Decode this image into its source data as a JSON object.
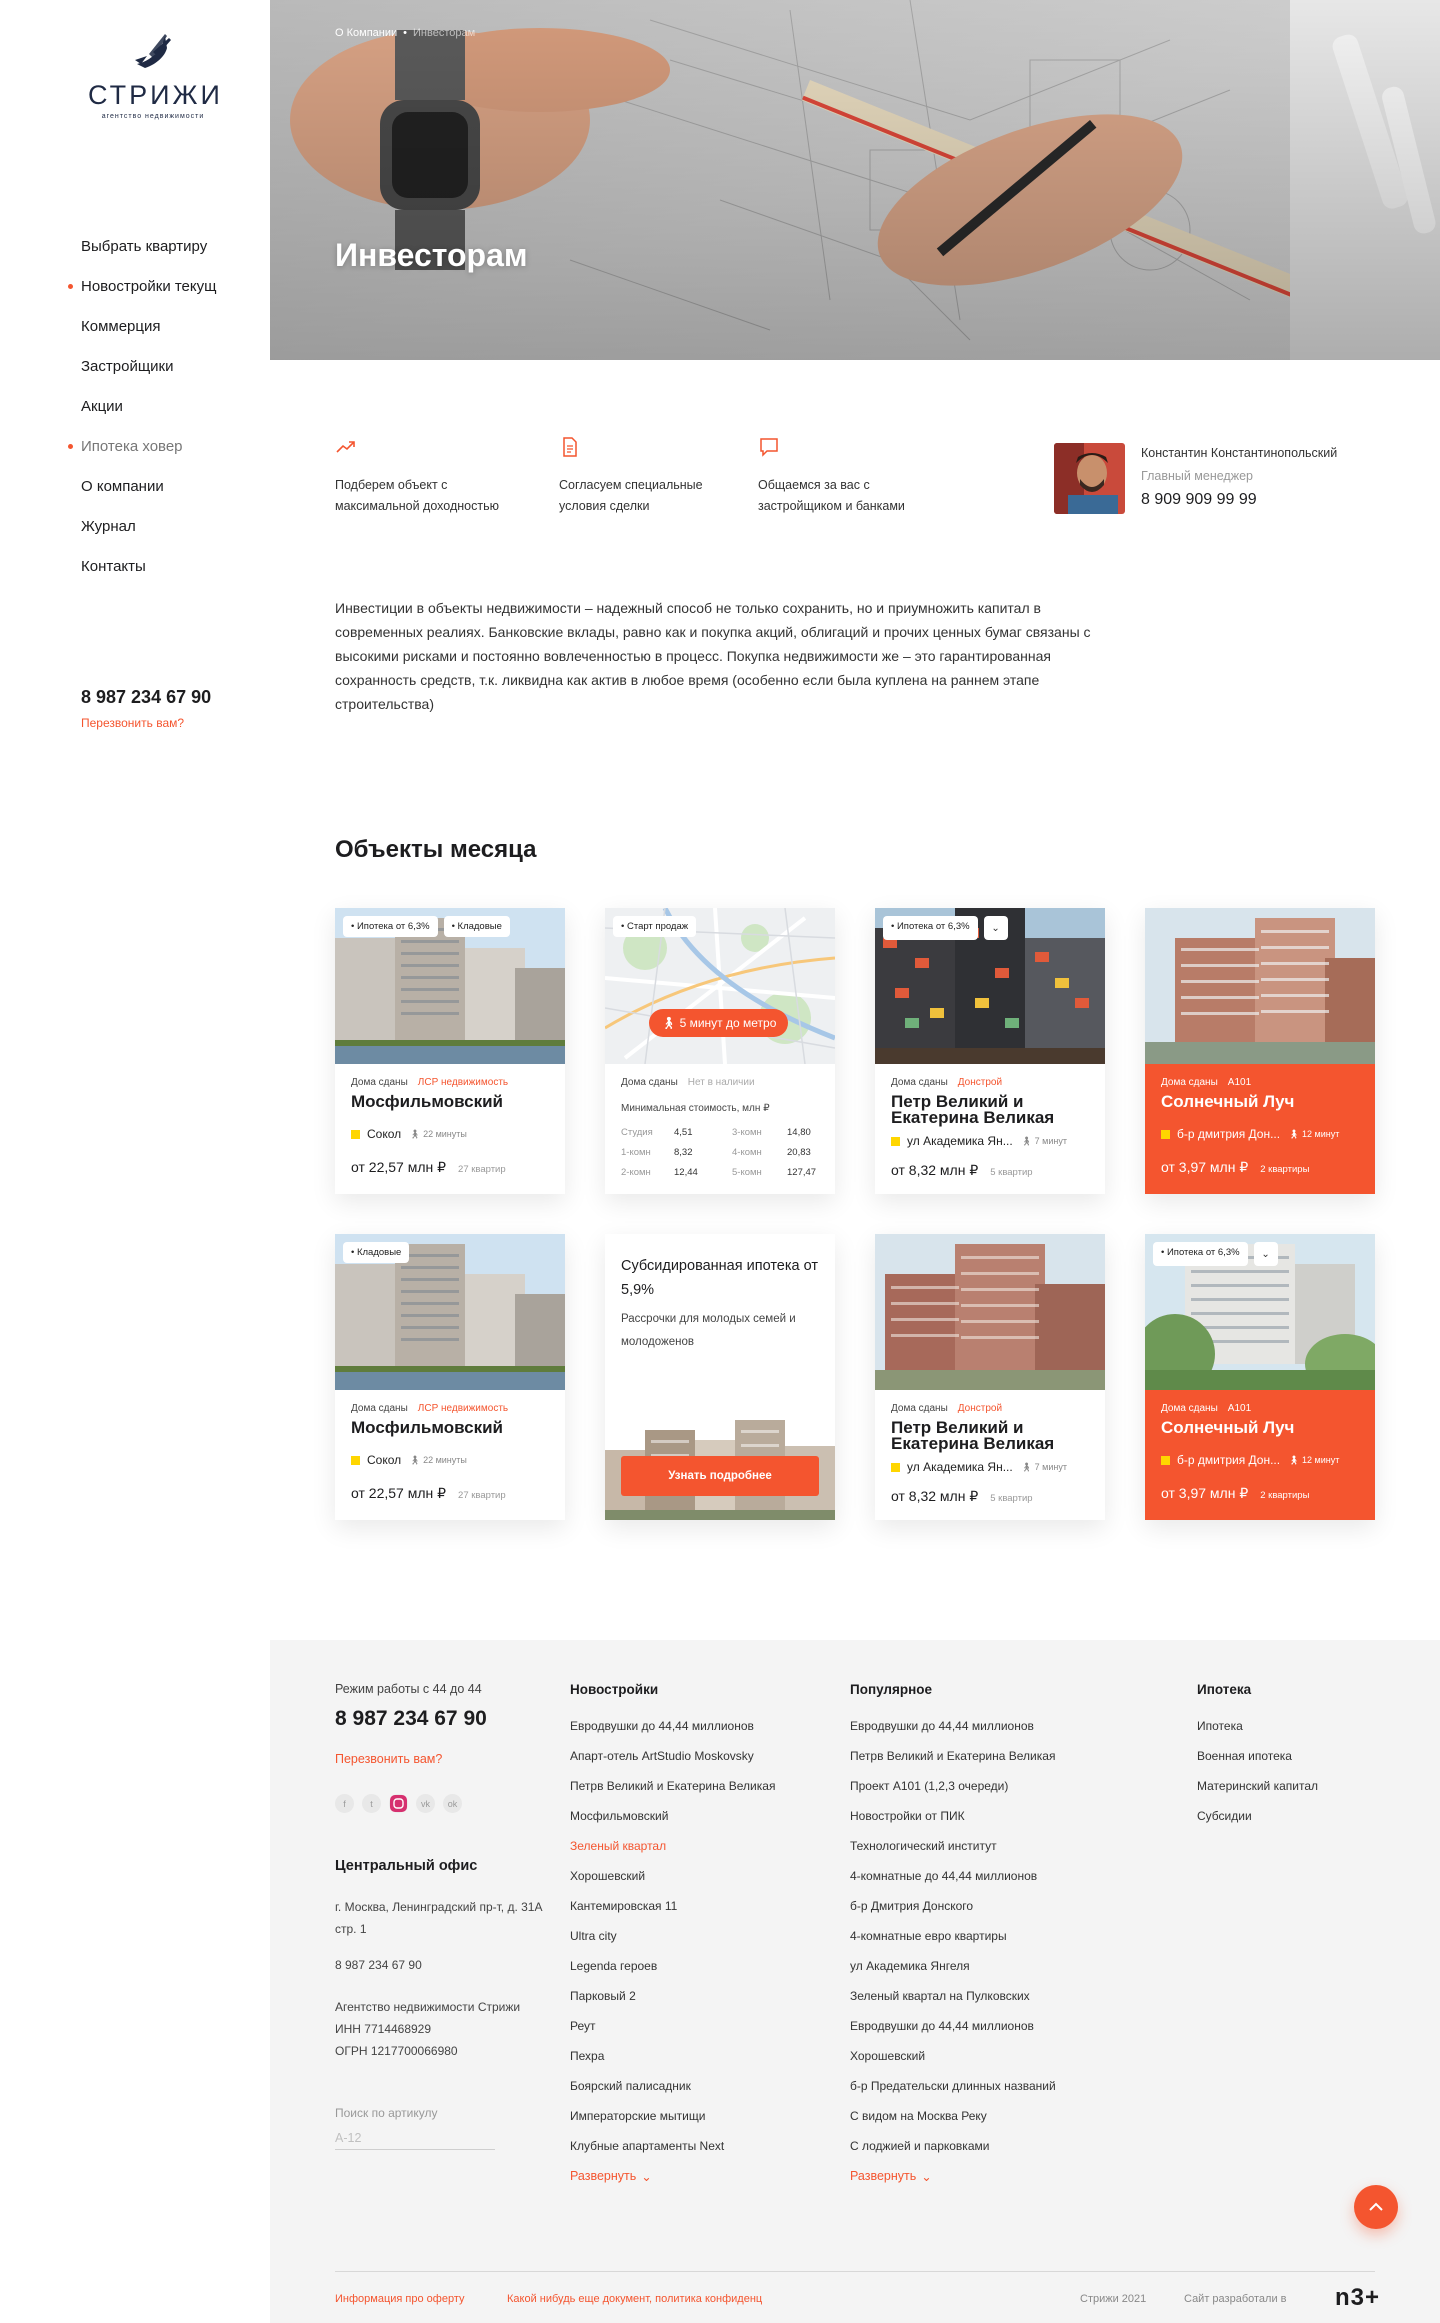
{
  "brand": {
    "name": "СТРИЖИ",
    "tagline": "агентство недвижимости"
  },
  "sidebar": {
    "nav": [
      {
        "label": "Выбрать квартиру",
        "dot": false
      },
      {
        "label": "Новостройки текущ",
        "dot": true
      },
      {
        "label": "Коммерция",
        "dot": false
      },
      {
        "label": "Застройщики",
        "dot": false
      },
      {
        "label": "Акции",
        "dot": false
      },
      {
        "label": "Ипотека ховер",
        "dot": true
      },
      {
        "label": "О компании",
        "dot": false
      },
      {
        "label": "Журнал",
        "dot": false
      },
      {
        "label": "Контакты",
        "dot": false
      }
    ],
    "phone": "8 987 234 67 90",
    "callback": "Перезвонить вам?"
  },
  "hero": {
    "breadcrumbs": [
      "О Компании",
      "Инвесторам"
    ],
    "title": "Инвесторам"
  },
  "features": [
    {
      "icon": "chart-up-icon",
      "text": "Подберем объект с максимальной доходностью"
    },
    {
      "icon": "document-icon",
      "text": "Согласуем специальные условия сделки"
    },
    {
      "icon": "chat-icon",
      "text": "Общаемся за вас с застройщиком и банками"
    }
  ],
  "manager": {
    "name": "Константин Константинопольский",
    "role": "Главный менеджер",
    "phone": "8 909 909 99 99"
  },
  "intro": "Инвестиции в объекты недвижимости – надежный способ не только сохранить, но и приумножить капитал в современных реалиях. Банковские вклады, равно как и покупка акций, облигаций и прочих ценных бумаг связаны с высокими рисками и постоянно вовлеченностью в процесс. Покупка недвижимости же – это гарантированная сохранность средств, т.к. ликвидна как актив в любое время (особенно если была куплена на раннем этапе строительства)",
  "section_title": "Объекты месяца",
  "cards": {
    "c1": {
      "tags": [
        "Ипотека от 6,3%",
        "Кладовые"
      ],
      "status": "Дома сданы",
      "developer": "ЛСР недвижимость",
      "title": "Мосфильмовский",
      "metro": "Сокол",
      "walk": "22 минуты",
      "price": "от 22,57 млн ₽",
      "count": "27 квартир"
    },
    "c2": {
      "tags": [
        "Старт продаж"
      ],
      "badge": "5 минут до метро",
      "status": "Дома сданы",
      "availability": "Нет в наличии",
      "subtitle": "Минимальная стоимость, млн ₽",
      "rows": [
        [
          "Студия",
          "4,51",
          "3-комн",
          "14,80"
        ],
        [
          "1-комн",
          "8,32",
          "4-комн",
          "20,83"
        ],
        [
          "2-комн",
          "12,44",
          "5-комн",
          "127,47"
        ]
      ]
    },
    "c3": {
      "tags": [
        "Ипотека от 6,3%"
      ],
      "status": "Дома сданы",
      "developer": "Донстрой",
      "title": "Петр Великий и Екатерина Великая",
      "metro": "ул Академика Ян...",
      "walk": "7 минут",
      "price": "от 8,32 млн ₽",
      "count": "5 квартир"
    },
    "c4": {
      "status": "Дома сданы",
      "developer": "А101",
      "title": "Солнечный Луч",
      "metro": "б-р дмитрия Дон...",
      "walk": "12 минут",
      "price": "от 3,97 млн ₽",
      "count": "2 квартиры"
    },
    "c5": {
      "tags": [
        "Кладовые"
      ],
      "status": "Дома сданы",
      "developer": "ЛСР недвижимость",
      "title": "Мосфильмовский",
      "metro": "Сокол",
      "walk": "22 минуты",
      "price": "от 22,57 млн ₽",
      "count": "27 квартир"
    },
    "c6": {
      "title": "Субсидированная ипотека от 5,9%",
      "text": "Рассрочки для молодых семей и молодоженов",
      "button": "Узнать подробнее"
    },
    "c7": {
      "status": "Дома сданы",
      "developer": "Донстрой",
      "title": "Петр Великий и Екатерина Великая",
      "metro": "ул Академика Ян...",
      "walk": "7 минут",
      "price": "от 8,32 млн ₽",
      "count": "5 квартир"
    },
    "c8": {
      "tags": [
        "Ипотека от 6,3%"
      ],
      "status": "Дома сданы",
      "developer": "А101",
      "title": "Солнечный Луч",
      "metro": "б-р дмитрия Дон...",
      "walk": "12 минут",
      "price": "от 3,97 млн ₽",
      "count": "2 квартиры"
    }
  },
  "footer": {
    "hours": "Режим работы с 44 до 44",
    "phone": "8 987 234 67 90",
    "callback": "Перезвонить вам?",
    "social": [
      "facebook-icon",
      "twitter-icon",
      "instagram-icon",
      "vk-icon",
      "ok-icon"
    ],
    "office_title": "Центральный офис",
    "address": "г. Москва, Ленинградский пр-т, д. 31А стр. 1",
    "office_phone": "8 987 234 67 90",
    "legal": [
      "Агентство недвижимости Стрижи",
      "ИНН  7714468929",
      "ОГРН 1217700066980"
    ],
    "search_label": "Поиск по артикулу",
    "search_placeholder": "А-12",
    "col_new": {
      "title": "Новостройки",
      "items": [
        "Евродвушки до 44,44 миллионов",
        "Апарт-отель ArtStudio Moskovsky",
        "Петрв Великий и Екатерина Великая",
        "Мосфильмовский",
        "Зеленый квартал",
        "Хорошевский",
        "Кантемировская 11",
        "Ultra city",
        "Legenda героев",
        "Парковый 2",
        "Реут",
        "Пехра",
        "Боярский палисадник",
        "Императорские мытищи",
        "Клубные апартаменты Next"
      ],
      "expand": "Развернуть"
    },
    "col_popular": {
      "title": "Популярное",
      "items": [
        "Евродвушки до 44,44 миллионов",
        "Петрв Великий и Екатерина Великая",
        "Проект А101 (1,2,3 очереди)",
        "Новостройки от ПИК",
        "Технологический институт",
        "4-комнатные до 44,44 миллионов",
        "б-р Дмитрия Донского",
        "4-комнатные евро квартиры",
        "ул Академика Янгеля",
        "Зеленый квартал на Пулковских",
        "Евродвушки до 44,44 миллионов",
        "Хорошевский",
        "б-р Предательски длинных названий",
        "С видом на Москва Реку",
        "С лоджией и парковками"
      ],
      "expand": "Развернуть"
    },
    "col_mortgage": {
      "title": "Ипотека",
      "items": [
        "Ипотека",
        "Военная ипотека",
        "Материнский капитал",
        "Субсидии"
      ]
    },
    "bottom": {
      "offer": "Информация про оферту",
      "policy": "Какой нибудь еще документ, политика конфиденц",
      "copyright": "Стрижи 2021",
      "made_by": "Сайт разработали в",
      "dev_logo": "n3+"
    }
  },
  "colors": {
    "accent": "#f4552f",
    "metro": "#ffd600",
    "footer_bg": "#f4f4f4"
  }
}
